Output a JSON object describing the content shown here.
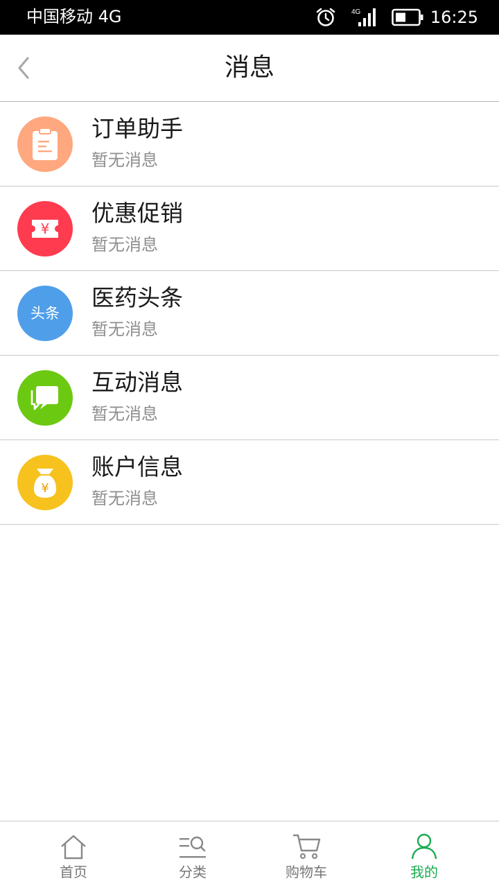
{
  "status_bar": {
    "carrier": "中国移动 4G",
    "network_label": "4G",
    "time": "16:25"
  },
  "header": {
    "title": "消息"
  },
  "messages": [
    {
      "title": "订单助手",
      "subtitle": "暂无消息",
      "icon": "clipboard-icon",
      "color": "#FFA77E"
    },
    {
      "title": "优惠促销",
      "subtitle": "暂无消息",
      "icon": "coupon-icon",
      "color": "#FF3B4F"
    },
    {
      "title": "医药头条",
      "subtitle": "暂无消息",
      "icon": "headline-icon",
      "icon_text": "头条",
      "color": "#4F9EEA"
    },
    {
      "title": "互动消息",
      "subtitle": "暂无消息",
      "icon": "chat-icon",
      "color": "#6CC912"
    },
    {
      "title": "账户信息",
      "subtitle": "暂无消息",
      "icon": "money-bag-icon",
      "color": "#F7C21E"
    }
  ],
  "coupon_symbol": "¥",
  "money_symbol": "¥",
  "bottom_nav": [
    {
      "label": "首页",
      "icon": "home-icon"
    },
    {
      "label": "分类",
      "icon": "category-search-icon"
    },
    {
      "label": "购物车",
      "icon": "cart-icon"
    },
    {
      "label": "我的",
      "icon": "user-icon",
      "active": true
    }
  ],
  "colors": {
    "accent": "#1AAC52",
    "nav_inactive": "#777777"
  }
}
